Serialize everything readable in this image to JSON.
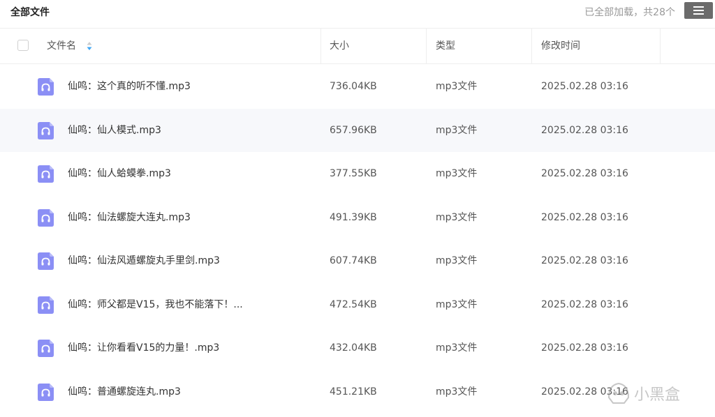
{
  "toolbar": {
    "title": "全部文件",
    "status": "已全部加载，共28个",
    "menu_icon": "hamburger-icon"
  },
  "table": {
    "columns": [
      "文件名",
      "大小",
      "类型",
      "修改时间"
    ],
    "rows": [
      {
        "name": "仙鸣：这个真的听不懂.mp3",
        "size": "736.04KB",
        "type": "mp3文件",
        "modified": "2025.02.28 03:16"
      },
      {
        "name": "仙鸣：仙人模式.mp3",
        "size": "657.96KB",
        "type": "mp3文件",
        "modified": "2025.02.28 03:16"
      },
      {
        "name": "仙鸣：仙人蛤蟆拳.mp3",
        "size": "377.55KB",
        "type": "mp3文件",
        "modified": "2025.02.28 03:16"
      },
      {
        "name": "仙鸣：仙法螺旋大连丸.mp3",
        "size": "491.39KB",
        "type": "mp3文件",
        "modified": "2025.02.28 03:16"
      },
      {
        "name": "仙鸣：仙法风遁螺旋丸手里剑.mp3",
        "size": "607.74KB",
        "type": "mp3文件",
        "modified": "2025.02.28 03:16"
      },
      {
        "name": "仙鸣：师父都是V15，我也不能落下！...",
        "size": "472.54KB",
        "type": "mp3文件",
        "modified": "2025.02.28 03:16"
      },
      {
        "name": "仙鸣：让你看看V15的力量！.mp3",
        "size": "432.04KB",
        "type": "mp3文件",
        "modified": "2025.02.28 03:16"
      },
      {
        "name": "仙鸣：普通螺旋连丸.mp3",
        "size": "451.21KB",
        "type": "mp3文件",
        "modified": "2025.02.28 03:16"
      }
    ],
    "row_icon": "audio-file-icon",
    "hovered_row": 1
  },
  "watermark": {
    "text": "小黑盒"
  },
  "colors": {
    "icon": "#8b8ff5",
    "sort_active": "#3fa7f5",
    "sort_inactive": "#cccccc",
    "hover_row": "#f7f8fb"
  }
}
